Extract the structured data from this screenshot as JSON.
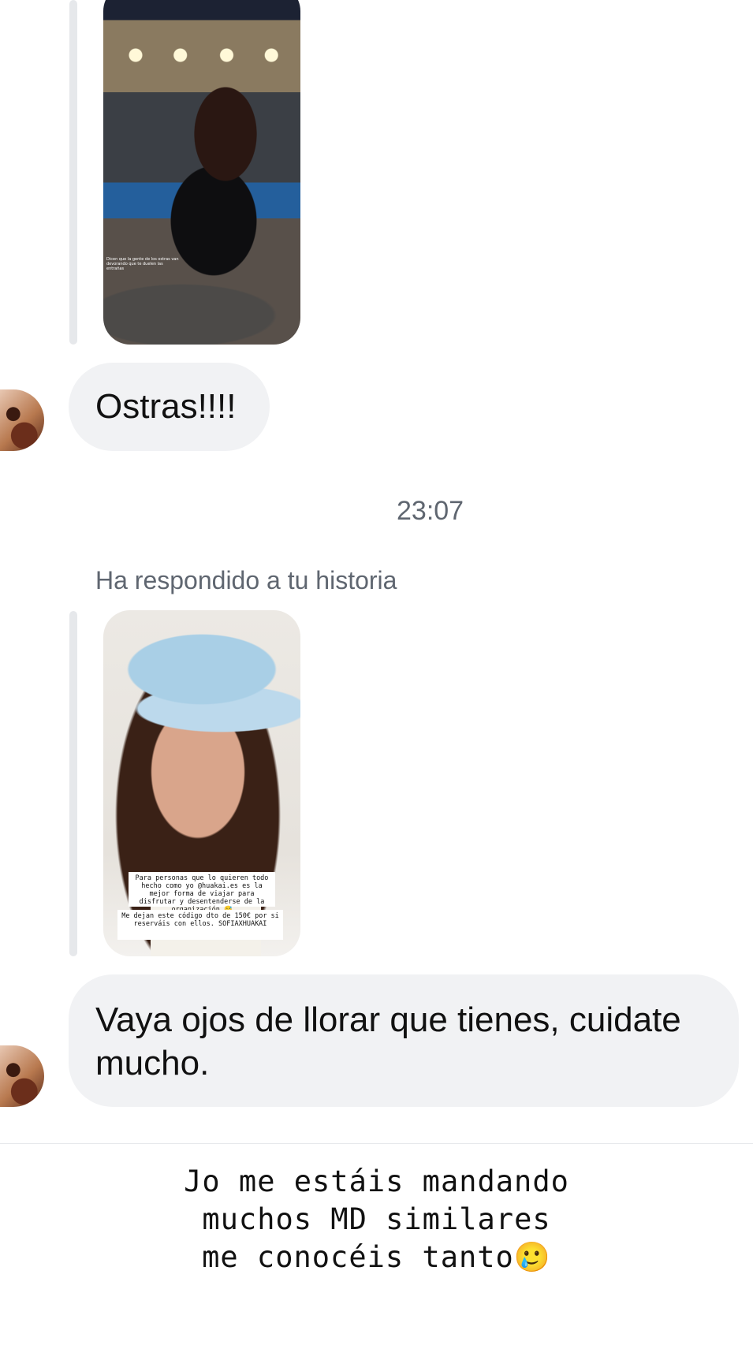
{
  "messages": {
    "first_reply_text": "Ostras!!!!",
    "timestamp": "23:07",
    "reply_context": "Ha respondido a tu historia",
    "second_reply_text": "Vaya ojos de llorar que tienes, cuidate mucho."
  },
  "story1": {
    "overlay_text": "Dicen que la gente de los ostras van devorando que te duelen las entrañas"
  },
  "story2": {
    "caption_top": "Para personas que lo quieren todo hecho como yo @huakai.es es la mejor forma de viajar para disfrutar y desentenderse de la organización 😅",
    "caption_bottom": "Me dejan este código dto de 150€ por si reserváis con ellos. SOFIAXHUAKAI"
  },
  "footer": {
    "caption_line1": "Jo me estáis mandando",
    "caption_line2": "muchos MD similares",
    "caption_line3": "me conocéis tanto🥲"
  },
  "colors": {
    "bubble_bg": "#f1f2f4",
    "quote_bar": "#e6e8eb",
    "meta_text": "#5f6670"
  }
}
